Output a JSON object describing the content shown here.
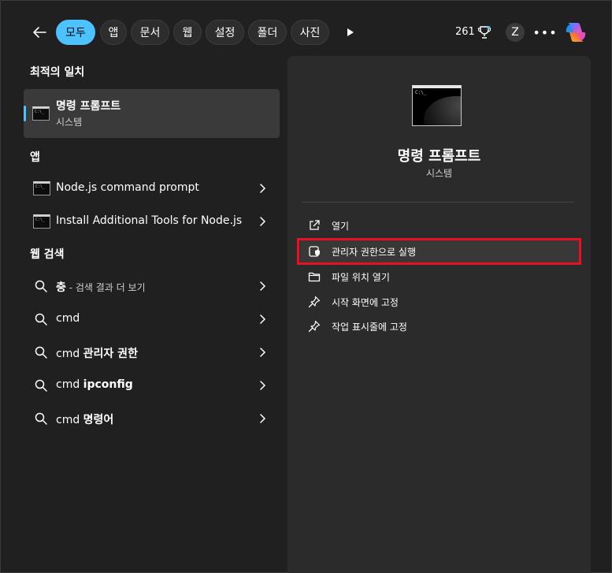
{
  "top_bar": {
    "filters": [
      "모두",
      "앱",
      "문서",
      "웹",
      "설정",
      "폴더",
      "사진"
    ],
    "active_filter": "모두",
    "points": "261",
    "user_initial": "Z",
    "more_label": "•••"
  },
  "left": {
    "best_match_heading": "최적의 일치",
    "best_match": {
      "title": "명령 프롬프트",
      "subtitle": "시스템",
      "icon": "cmd-icon"
    },
    "apps_heading": "앱",
    "apps": [
      {
        "label": "Node.js command prompt",
        "icon": "cmd-icon"
      },
      {
        "label": "Install Additional Tools for Node.js",
        "icon": "cmd-icon"
      }
    ],
    "web_heading": "웹 검색",
    "web_results": [
      {
        "bold": "충",
        "rest": " - 검색 결과 더 보기",
        "prefix": ""
      },
      {
        "bold": "",
        "rest": "",
        "prefix": "cmd"
      },
      {
        "bold": "관리자 권한",
        "rest": "",
        "prefix": "cmd "
      },
      {
        "bold": "ipconfig",
        "rest": "",
        "prefix": "cmd "
      },
      {
        "bold": "명령어",
        "rest": "",
        "prefix": "cmd "
      }
    ]
  },
  "preview": {
    "title": "명령 프롬프트",
    "subtitle": "시스템",
    "icon_caption": "C:\\_"
  },
  "actions": [
    {
      "label": "열기",
      "icon": "open-external-icon"
    },
    {
      "label": "관리자 권한으로 실행",
      "icon": "shield-admin-icon"
    },
    {
      "label": "파일 위치 열기",
      "icon": "folder-icon"
    },
    {
      "label": "시작 화면에 고정",
      "icon": "pin-icon"
    },
    {
      "label": "작업 표시줄에 고정",
      "icon": "pin-icon"
    }
  ],
  "colors": {
    "accent": "#4cc2ff",
    "highlight_border": "#e81123",
    "background": "#202020",
    "panel": "#2b2b2b"
  }
}
